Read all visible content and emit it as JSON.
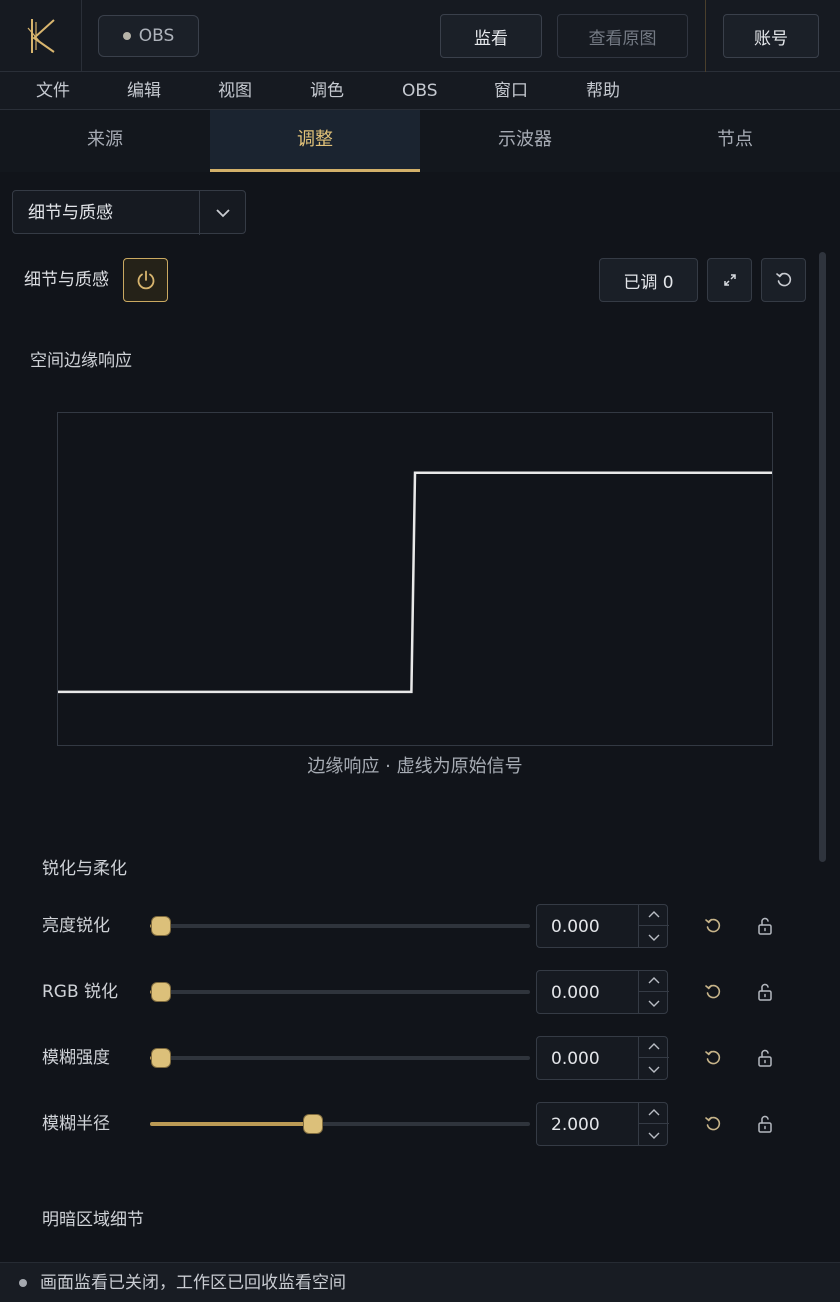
{
  "topbar": {
    "obs_label": "OBS",
    "monitor_label": "监看",
    "view_original_label": "查看原图",
    "account_label": "账号"
  },
  "menu": [
    "文件",
    "编辑",
    "视图",
    "调色",
    "OBS",
    "窗口",
    "帮助"
  ],
  "tabs": [
    "来源",
    "调整",
    "示波器",
    "节点"
  ],
  "active_tab": 1,
  "module_select": {
    "value": "细节与质感"
  },
  "section": {
    "title": "细节与质感",
    "adjusted_label": "已调 0"
  },
  "chart_section_title": "空间边缘响应",
  "chart_data": {
    "type": "line",
    "caption": "边缘响应 · 虚线为原始信号",
    "series": [
      {
        "x": [
          0,
          0.495,
          0.5,
          1
        ],
        "y": [
          0.16,
          0.16,
          0.82,
          0.82
        ]
      }
    ],
    "xlim": [
      0,
      1
    ],
    "ylim": [
      0,
      1
    ]
  },
  "group_sharpen": {
    "title": "锐化与柔化",
    "params": [
      {
        "label": "亮度锐化",
        "value": "0.000",
        "fraction": 0.03
      },
      {
        "label": "RGB 锐化",
        "value": "0.000",
        "fraction": 0.03
      },
      {
        "label": "模糊强度",
        "value": "0.000",
        "fraction": 0.03
      },
      {
        "label": "模糊半径",
        "value": "2.000",
        "fraction": 0.43
      }
    ]
  },
  "group_tonal": {
    "title": "明暗区域细节"
  },
  "status": {
    "text": "画面监看已关闭，工作区已回收监看空间"
  },
  "colors": {
    "accent": "#d2b06a",
    "background": "#11141a",
    "curve": "#e8e8e8"
  }
}
